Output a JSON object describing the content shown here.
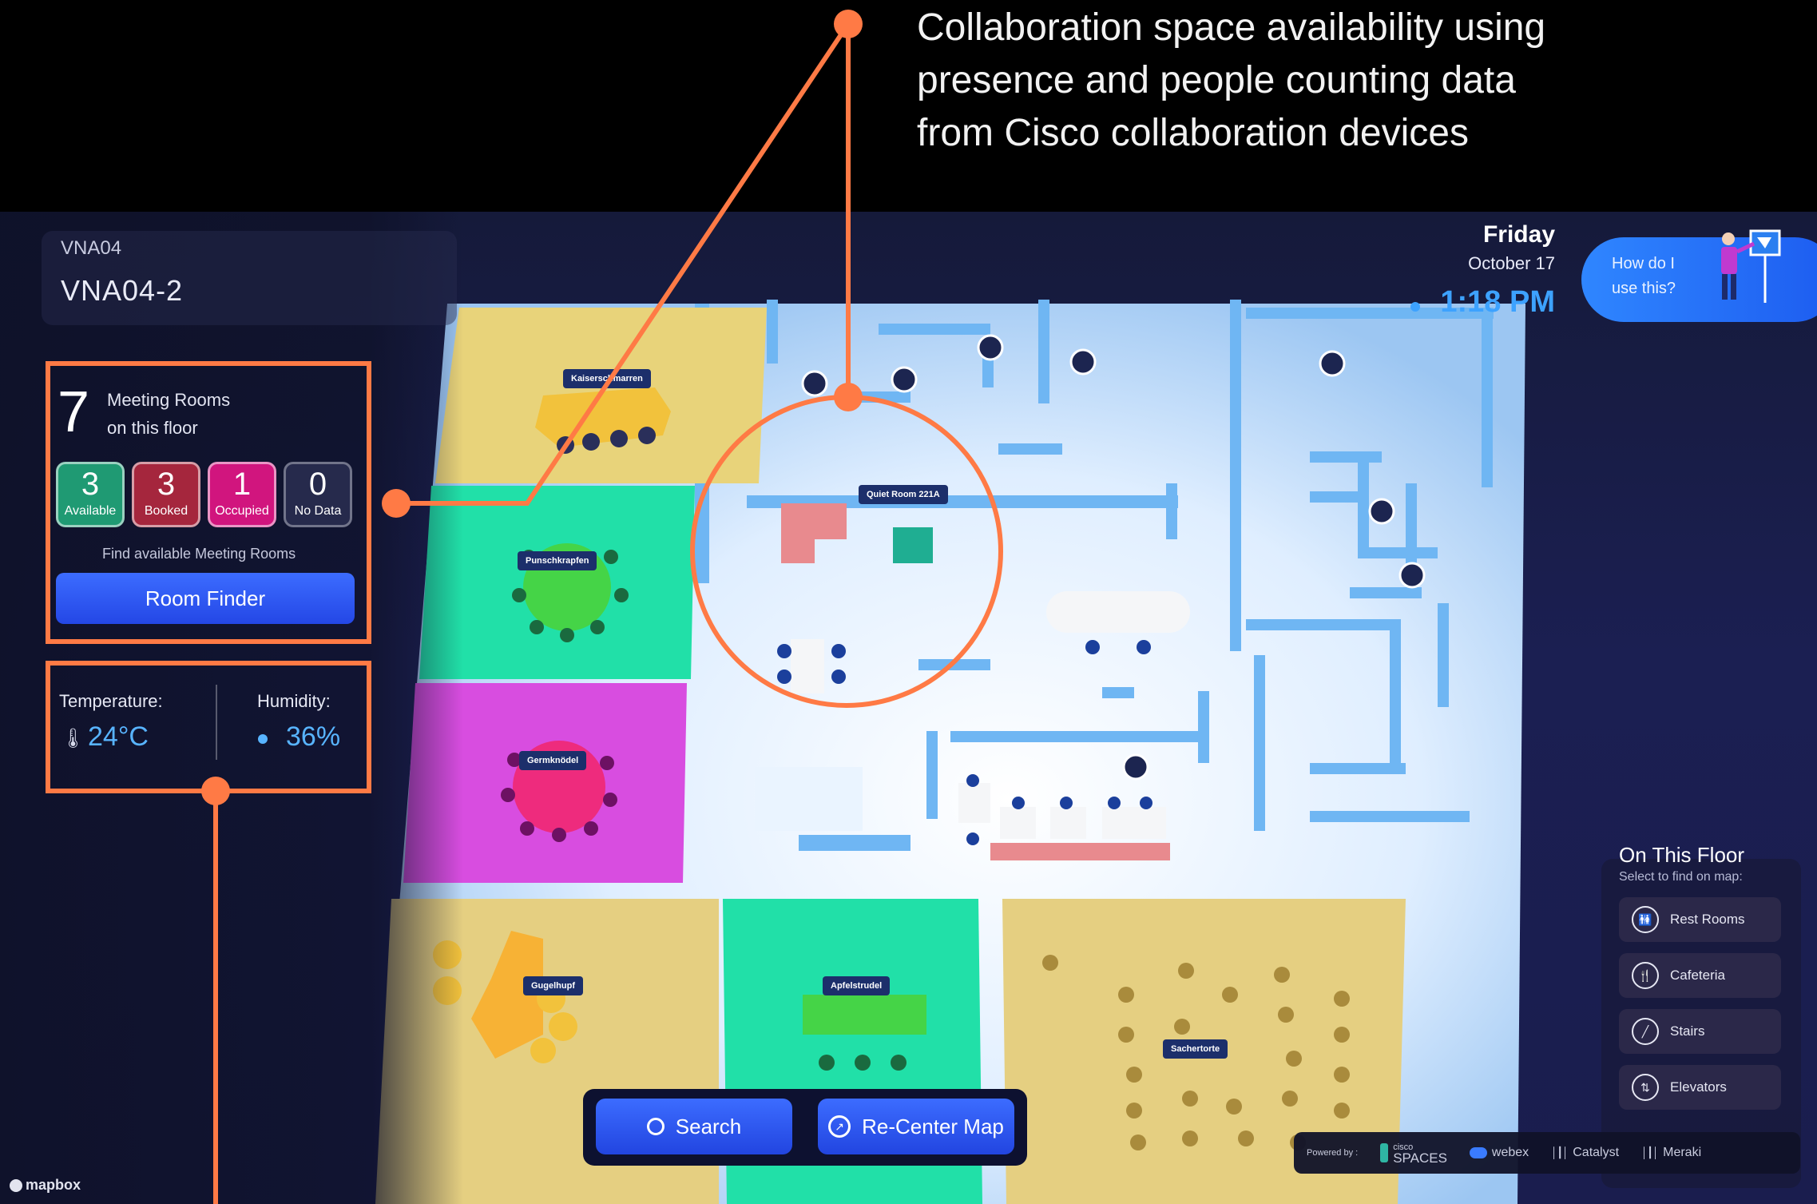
{
  "callout": {
    "lines": [
      "Collaboration space availability using",
      "presence and people counting data",
      "from Cisco collaboration devices"
    ]
  },
  "building": {
    "code": "VNA04",
    "floor": "VNA04-2"
  },
  "rooms": {
    "count": "7",
    "label_line1": "Meeting Rooms",
    "label_line2": "on this floor",
    "stats": [
      {
        "value": "3",
        "label": "Available",
        "color": "#1f9a73"
      },
      {
        "value": "3",
        "label": "Booked",
        "color": "#a5263d"
      },
      {
        "value": "1",
        "label": "Occupied",
        "color": "#d1157e"
      },
      {
        "value": "0",
        "label": "No Data",
        "color": "#262a4c"
      }
    ],
    "find_text": "Find available Meeting Rooms",
    "room_finder_label": "Room Finder"
  },
  "environment": {
    "temperature_label": "Temperature:",
    "temperature_value": "24°C",
    "humidity_label": "Humidity:",
    "humidity_value": "36%"
  },
  "datetime": {
    "day": "Friday",
    "date": "October 17",
    "time": "1:18 PM"
  },
  "help": {
    "line1": "How do I",
    "line2": "use this?"
  },
  "floor_panel": {
    "title": "On This Floor",
    "subtitle": "Select to find on map:",
    "items": [
      {
        "label": "Rest Rooms",
        "icon": "restroom-icon"
      },
      {
        "label": "Cafeteria",
        "icon": "cafeteria-icon"
      },
      {
        "label": "Stairs",
        "icon": "stairs-icon"
      },
      {
        "label": "Elevators",
        "icon": "elevator-icon"
      }
    ]
  },
  "rooms_on_map": {
    "kaiserschmarren": "Kaiserschmarren",
    "punschkrapfen": "Punschkrapfen",
    "germknodel": "Germknödel",
    "gugelhupf": "Gugelhupf",
    "apfelstrudel": "Apfelstrudel",
    "sachertorte": "Sachertorte",
    "quiet_room": "Quiet Room 221A"
  },
  "bottom": {
    "search_label": "Search",
    "recenter_label": "Re-Center Map"
  },
  "powered_by": {
    "prefix": "Powered by :",
    "spaces_small": "cisco",
    "spaces": "SPACES",
    "webex": "webex",
    "catalyst": "Catalyst",
    "meraki": "Meraki"
  },
  "attribution": "mapbox",
  "colors": {
    "accent": "#ff7a45",
    "time_blue": "#3da2ff",
    "button_blue": "#2f5bff",
    "room_yellow": "#e8d37a",
    "room_green": "#21e0a8",
    "room_magenta": "#d84de0"
  }
}
